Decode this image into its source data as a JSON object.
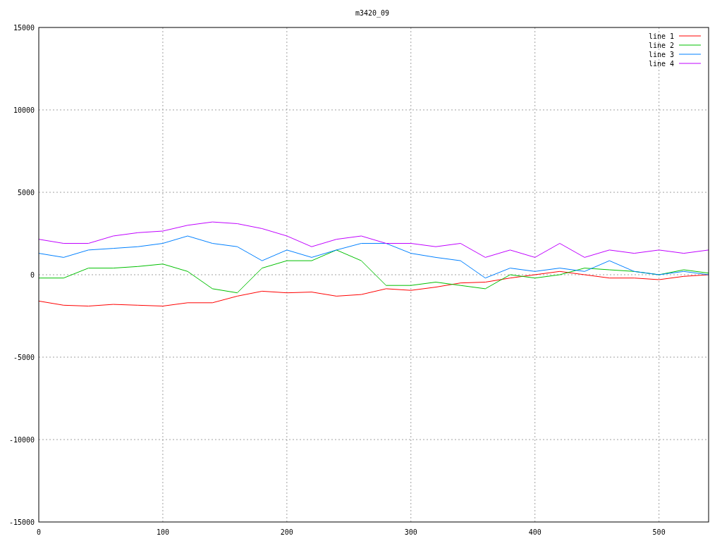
{
  "chart_data": {
    "type": "line",
    "title": "m3420_09",
    "x": [
      0,
      20,
      40,
      60,
      80,
      100,
      120,
      140,
      160,
      180,
      200,
      220,
      240,
      260,
      280,
      300,
      320,
      340,
      360,
      380,
      400,
      420,
      440,
      460,
      480,
      500,
      520,
      540
    ],
    "xlim": [
      0,
      540
    ],
    "ylim": [
      -15000,
      15000
    ],
    "xticks": [
      0,
      100,
      200,
      300,
      400,
      500
    ],
    "yticks": [
      -15000,
      -10000,
      -5000,
      0,
      5000,
      10000,
      15000
    ],
    "grid": true,
    "legend": "top-right",
    "series": [
      {
        "name": "line 1",
        "color": "#ff0000",
        "values": [
          -1600,
          -1850,
          -1900,
          -1800,
          -1850,
          -1900,
          -1700,
          -1700,
          -1300,
          -1000,
          -1100,
          -1050,
          -1300,
          -1200,
          -850,
          -950,
          -750,
          -500,
          -450,
          -200,
          0,
          200,
          0,
          -200,
          -200,
          -300,
          -100,
          0
        ]
      },
      {
        "name": "line 2",
        "color": "#00c000",
        "values": [
          -200,
          -200,
          400,
          400,
          500,
          650,
          200,
          -850,
          -1100,
          400,
          850,
          850,
          1500,
          850,
          -650,
          -650,
          -450,
          -650,
          -850,
          0,
          -200,
          0,
          400,
          300,
          200,
          0,
          300,
          100
        ]
      },
      {
        "name": "line 3",
        "color": "#0080ff",
        "values": [
          1300,
          1050,
          1500,
          1600,
          1700,
          1900,
          2350,
          1900,
          1700,
          850,
          1500,
          1050,
          1500,
          1900,
          1900,
          1300,
          1050,
          850,
          -200,
          400,
          200,
          400,
          200,
          850,
          200,
          0,
          200,
          0
        ]
      },
      {
        "name": "line 4",
        "color": "#c000ff",
        "values": [
          2150,
          1900,
          1900,
          2350,
          2550,
          2650,
          3000,
          3200,
          3100,
          2800,
          2350,
          1700,
          2150,
          2350,
          1900,
          1900,
          1700,
          1900,
          1050,
          1500,
          1050,
          1900,
          1050,
          1500,
          1300,
          1500,
          1300,
          1500
        ]
      }
    ]
  }
}
